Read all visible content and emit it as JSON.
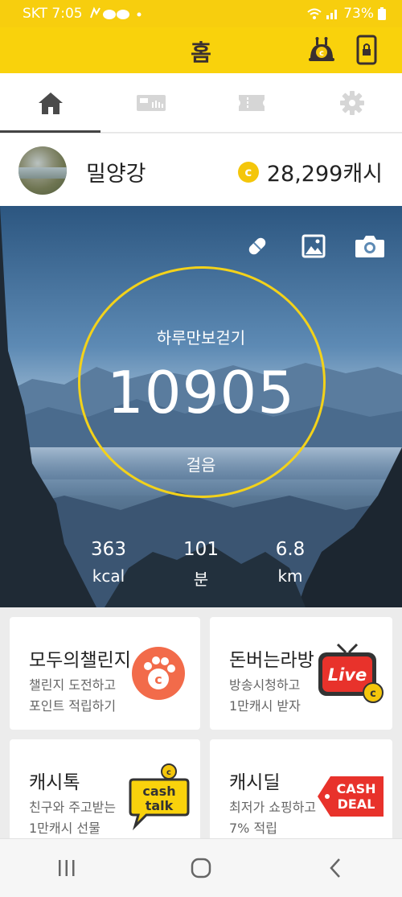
{
  "status_bar": {
    "carrier_time": "SKT 7:05",
    "battery": "73%"
  },
  "header": {
    "title": "홈",
    "coin_char": "c"
  },
  "tabs": [
    {
      "name": "home-icon",
      "active": true
    },
    {
      "name": "ticket-icon",
      "active": false
    },
    {
      "name": "coupon-icon",
      "active": false
    },
    {
      "name": "gear-icon",
      "active": false
    }
  ],
  "profile": {
    "name": "밀양강",
    "coin_char": "c",
    "balance": "28,299캐시"
  },
  "hero": {
    "label": "하루만보걷기",
    "steps": "10905",
    "steps_unit": "걸음",
    "stats": [
      {
        "value": "363",
        "unit": "kcal"
      },
      {
        "value": "101",
        "unit": "분"
      },
      {
        "value": "6.8",
        "unit": "km"
      }
    ]
  },
  "cards": [
    {
      "title": "모두의챌린지",
      "desc1": "챌린지 도전하고",
      "desc2": "포인트 적립하기",
      "icon": "paw-c-icon"
    },
    {
      "title": "돈버는라방",
      "desc1": "방송시청하고",
      "desc2": "1만캐시 받자",
      "icon": "live-tv-icon",
      "badge": "Live"
    },
    {
      "title": "캐시톡",
      "desc1": "친구와 주고받는",
      "desc2": "1만캐시 선물",
      "icon": "cash-talk-icon",
      "badge_line1": "cash",
      "badge_line2": "talk"
    },
    {
      "title": "캐시딜",
      "desc1": "최저가 쇼핑하고",
      "desc2": "7% 적립",
      "icon": "cash-deal-icon",
      "badge_line1": "CASH",
      "badge_line2": "DEAL"
    }
  ],
  "colors": {
    "brand_yellow": "#f9d20c",
    "ring": "#f3d21a",
    "challenge_orange": "#f26b4a",
    "live_red": "#e8322b"
  }
}
